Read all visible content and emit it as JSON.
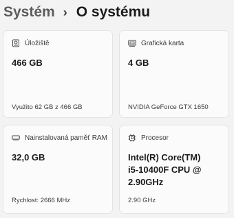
{
  "breadcrumb": {
    "parent": "Systém",
    "separator": "›",
    "current": "O systému"
  },
  "cards": {
    "storage": {
      "icon": "storage-icon",
      "title": "Úložiště",
      "value": "466 GB",
      "detail": "Využito 62 GB z 466 GB"
    },
    "gpu": {
      "icon": "graphics-card-icon",
      "title": "Grafická karta",
      "value": "4 GB",
      "detail": "NVIDIA GeForce GTX 1650"
    },
    "ram": {
      "icon": "memory-icon",
      "title": "Nainstalovaná paměť RAM",
      "value": "32,0 GB",
      "detail": "Rychlost: 2666 MHz"
    },
    "cpu": {
      "icon": "processor-icon",
      "title": "Procesor",
      "value_lines": [
        "Intel(R) Core(TM)",
        "i5-10400F CPU @",
        "2.90GHz"
      ],
      "detail": "2.90 GHz"
    }
  },
  "colors": {
    "background": "#f3f3f3",
    "card": "#fbfbfb",
    "border": "#e3e3e3"
  }
}
